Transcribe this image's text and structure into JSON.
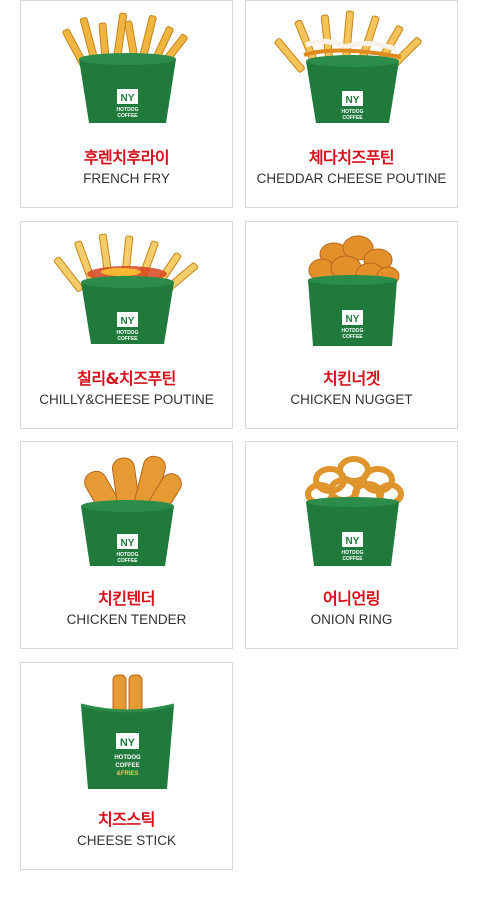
{
  "menu": {
    "items": [
      {
        "name_ko": "후렌치후라이",
        "name_en": "FRENCH FRY",
        "icon": "french-fry-cup-icon"
      },
      {
        "name_ko": "체다치즈푸틴",
        "name_en": "CHEDDAR CHEESE POUTINE",
        "icon": "cheddar-poutine-cup-icon"
      },
      {
        "name_ko": "칠리&치즈푸틴",
        "name_en": "CHILLY&CHEESE POUTINE",
        "icon": "chilly-poutine-cup-icon"
      },
      {
        "name_ko": "치킨너겟",
        "name_en": "CHICKEN NUGGET",
        "icon": "chicken-nugget-cup-icon"
      },
      {
        "name_ko": "치킨텐더",
        "name_en": "CHICKEN TENDER",
        "icon": "chicken-tender-cup-icon"
      },
      {
        "name_ko": "어니언링",
        "name_en": "ONION RING",
        "icon": "onion-ring-cup-icon"
      },
      {
        "name_ko": "치즈스틱",
        "name_en": "CHEESE STICK",
        "icon": "cheese-stick-sleeve-icon"
      }
    ]
  },
  "brand": {
    "logo_text": "NY",
    "cup_lines": [
      "HOTDOG",
      "COFFEE",
      "&FRIES"
    ]
  },
  "colors": {
    "title_red": "#d7101c",
    "cup_green": "#1f7a3c",
    "border": "#d9d9d9"
  }
}
